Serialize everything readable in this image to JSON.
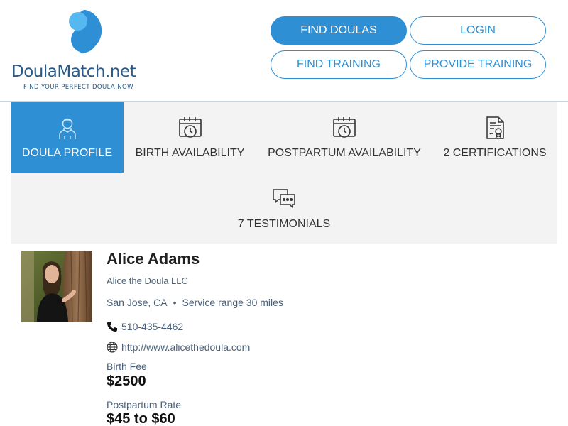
{
  "brand": {
    "name_part1": "Doula",
    "name_part2": "Match",
    "name_part3": ".net",
    "tagline": "FIND YOUR PERFECT DOULA NOW",
    "colors": {
      "light_blue": "#56b8f0",
      "dark_blue": "#2b5a86",
      "accent": "#2e8fd5"
    }
  },
  "nav": {
    "find_doulas": "FIND DOULAS",
    "login": "LOGIN",
    "find_training": "FIND TRAINING",
    "provide_training": "PROVIDE TRAINING"
  },
  "tabs": [
    {
      "label": "DOULA PROFILE",
      "icon": "doula-avatar-icon",
      "active": true
    },
    {
      "label": "BIRTH AVAILABILITY",
      "icon": "calendar-clock-icon",
      "active": false
    },
    {
      "label": "POSTPARTUM AVAILABILITY",
      "icon": "calendar-clock-icon",
      "active": false
    },
    {
      "label": "2 CERTIFICATIONS",
      "icon": "certificate-icon",
      "active": false
    },
    {
      "label": "7 TESTIMONIALS",
      "icon": "chat-bubbles-icon",
      "active": false
    }
  ],
  "profile": {
    "name": "Alice Adams",
    "business": "Alice the Doula LLC",
    "location": "San Jose, CA",
    "separator": "•",
    "service_range": "Service range 30 miles",
    "phone": "510-435-4462",
    "website": "http://www.alicethedoula.com",
    "birth_fee_label": "Birth Fee",
    "birth_fee": "$2500",
    "postpartum_label": "Postpartum Rate",
    "postpartum_rate": "$45 to $60"
  }
}
